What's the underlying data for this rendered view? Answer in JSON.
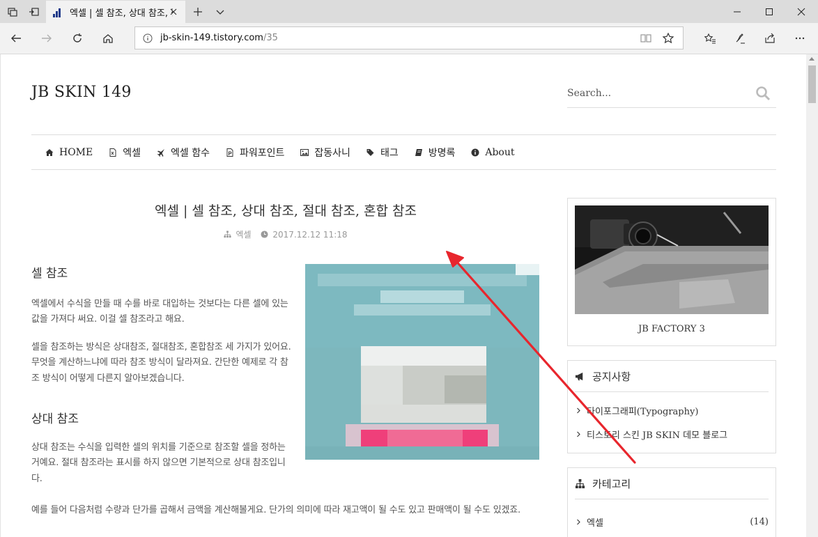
{
  "browser": {
    "tab_title": "엑셀 | 셀 참조, 상대 참조, 절대 참조, 혼합 참조",
    "url_host": "jb-skin-149.tistory.com",
    "url_path": "/35"
  },
  "site": {
    "title": "JB SKIN 149",
    "search_placeholder": "Search..."
  },
  "menu": [
    {
      "label": "HOME",
      "icon": "home-icon"
    },
    {
      "label": "엑셀",
      "icon": "excel-file-icon"
    },
    {
      "label": "엑셀 함수",
      "icon": "plane-icon"
    },
    {
      "label": "파워포인트",
      "icon": "powerpoint-file-icon"
    },
    {
      "label": "잡동사니",
      "icon": "image-icon"
    },
    {
      "label": "태그",
      "icon": "tags-icon"
    },
    {
      "label": "방명록",
      "icon": "book-icon"
    },
    {
      "label": "About",
      "icon": "info-icon"
    }
  ],
  "post": {
    "title": "엑셀 | 셀 참조, 상대 참조, 절대 참조, 혼합 참조",
    "category": "엑셀",
    "date": "2017.12.12 11:18",
    "section1_heading": "셀 참조",
    "section1_p1": "엑셀에서 수식을 만들 때 수를 바로 대입하는 것보다는 다른 셀에 있는 값을 가져다 써요. 이걸 셀 참조라고 해요.",
    "section1_p2": "셀을 참조하는 방식은 상대참조, 절대참조, 혼합참조 세 가지가 있어요. 무엇을 계산하느냐에 따라 참조 방식이 달라져요. 간단한 예제로 각 참조 방식이 어떻게 다른지 알아보겠습니다.",
    "section2_heading": "상대 참조",
    "section2_p1": "상대 참조는 수식을 입력한 셀의 위치를 기준으로 참조할 셀을 정하는 거예요. 절대 참조라는 표시를 하지 않으면 기본적으로 상대 참조입니다.",
    "section2_p2": "예를 들어 다음처럼 수량과 단가를 곱해서 금액을 계산해볼게요. 단가의 의미에 따라 재고액이 될 수도 있고 판매액이 될 수도 있겠죠."
  },
  "sidebar": {
    "photo_caption": "JB FACTORY 3",
    "notice": {
      "title": "공지사항",
      "items": [
        "타이포그래피(Typography)",
        "티스토리 스킨 JB SKIN 데모 블로그"
      ]
    },
    "category": {
      "title": "카테고리",
      "items": [
        {
          "label": "엑셀",
          "count": "(14)"
        }
      ]
    }
  },
  "colors": {
    "annotation_arrow": "#e8262d",
    "ad_teal": "#6fb0b8",
    "ad_pink": "#ef3f7a"
  }
}
